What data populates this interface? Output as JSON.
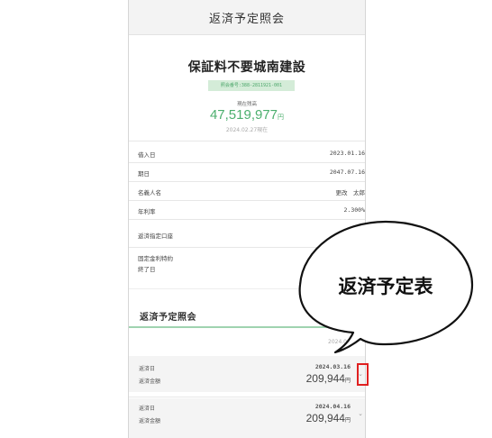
{
  "header": {
    "title": "返済予定照会"
  },
  "loan": {
    "name": "保証料不要城南建設",
    "account": "照会番号:388-2811921-001",
    "balance_label": "現在残高",
    "balance": "47,519,977",
    "currency": "円",
    "balance_date": "2024.02.27現在"
  },
  "details": [
    {
      "label": "借入日",
      "value": "2023.01.16"
    },
    {
      "label": "期日",
      "value": "2047.07.16"
    },
    {
      "label": "名義人名",
      "value": "更改　太郎"
    },
    {
      "label": "年利率",
      "value": "2.300%"
    },
    {
      "label": "返済指定口座",
      "value": ""
    },
    {
      "label": "固定金利特約",
      "label2": "終了日",
      "value": ""
    }
  ],
  "schedule": {
    "title": "返済予定照会",
    "date_hint": "2024.0",
    "items": [
      {
        "date_label": "返済日",
        "date": "2024.03.16",
        "amount_label": "返済金額",
        "amount": "209,944",
        "currency": "円"
      },
      {
        "date_label": "返済日",
        "date": "2024.04.16",
        "amount_label": "返済金額",
        "amount": "209,944",
        "currency": "円"
      }
    ]
  },
  "callout": {
    "text": "返済予定表"
  },
  "colors": {
    "accent_green": "#4caf6e",
    "badge_bg": "#d4ecd8",
    "highlight_red": "#e02020"
  },
  "icons": {
    "chevron": "chevron-down-icon"
  }
}
